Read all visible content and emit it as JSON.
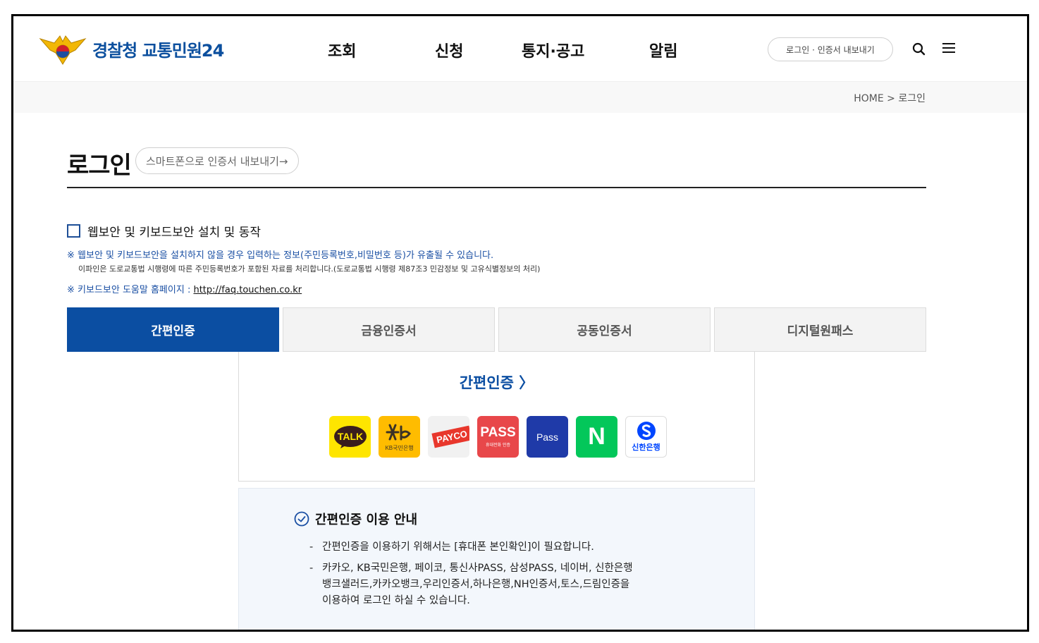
{
  "header": {
    "logo_text": "경찰청 교통민원24",
    "nav": [
      "조회",
      "신청",
      "통지·공고",
      "알림"
    ],
    "login_pill": "로그인 · 인증서 내보내기",
    "icons": {
      "search": "search-icon",
      "menu": "hamburger-menu-icon"
    }
  },
  "breadcrumb": "HOME > 로그인",
  "page": {
    "title": "로그인",
    "export_button": "스마트폰으로 인증서 내보내기→"
  },
  "security": {
    "checkbox_label": "웹보안 및 키보드보안 설치 및 동작",
    "checked": false,
    "notice1": "※ 웹보안 및 키보드보안을 설치하지 않을 경우 입력하는 정보(주민등록번호,비밀번호 등)가 유출될 수 있습니다.",
    "notice2": "이파인은 도로교통법 시행령에 따른 주민등록번호가 포함된 자료를 처리합니다.(도로교통법 시행령 제87조3 민감정보 및 고유식별정보의 처리)",
    "notice3_prefix": "※ 키보드보안 도움말 홈페이지 : ",
    "notice3_link": "http://faq.touchen.co.kr"
  },
  "tabs": [
    "간편인증",
    "금융인증서",
    "공동인증서",
    "디지털원패스"
  ],
  "active_tab": "간편인증",
  "panel": {
    "title": "간편인증 〉",
    "providers": [
      {
        "name": "kakao-icon",
        "label": "TALK"
      },
      {
        "name": "kb-icon",
        "label": "KB국민은행"
      },
      {
        "name": "payco-icon",
        "label": "PAYCO"
      },
      {
        "name": "pass-icon",
        "label": "PASS",
        "sublabel": "휴대전화 인증"
      },
      {
        "name": "samsung-pass-icon",
        "label": "Pass"
      },
      {
        "name": "naver-icon",
        "label": "N"
      },
      {
        "name": "shinhan-icon",
        "label": "신한은행"
      }
    ]
  },
  "guide": {
    "title": "간편인증 이용 안내",
    "items": [
      "간편인증을 이용하기 위해서는 [휴대폰 본인확인]이 필요합니다.",
      "카카오, KB국민은행, 페이코, 통신사PASS, 삼성PASS, 네이버, 신한은행",
      "뱅크샐러드,카카오뱅크,우리인증서,하나은행,NH인증서,토스,드림인증을",
      "이용하여 로그인 하실 수 있습니다."
    ]
  },
  "colors": {
    "brand": "#0b4ea2",
    "kakao": "#fee500",
    "kb": "#ffbc00",
    "pass": "#e8474a",
    "samsung": "#1f3aa8",
    "naver": "#03c75a"
  }
}
